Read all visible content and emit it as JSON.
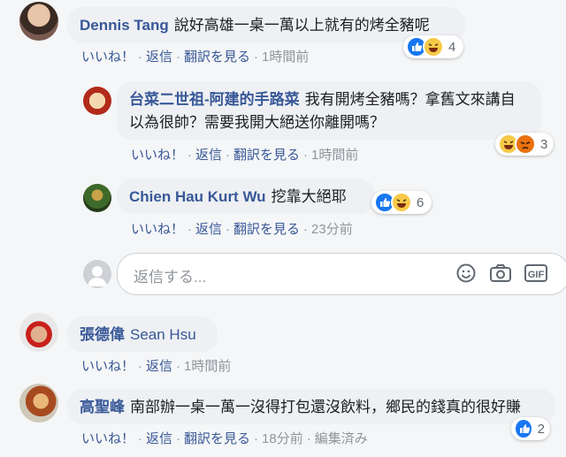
{
  "colors": {
    "link": "#385898",
    "like": "#1877f2",
    "haha": "#f7c948",
    "angry": "#e9710f",
    "bubble": "#eef0f3"
  },
  "comments": [
    {
      "name": "Dennis Tang",
      "text": "說好高雄一桌一萬以上就有的烤全豬呢",
      "actions": [
        "いいね！",
        "返信",
        "翻訳を見る"
      ],
      "time": "1時間前",
      "reactions": [
        "like",
        "haha"
      ],
      "reaction_count": "4"
    },
    {
      "name": "台菜二世祖-阿建的手路菜",
      "text_line1": "我有開烤全豬嗎？拿舊文來講自",
      "text_line2": "以為很帥？需要我開大絕送你離開嗎？",
      "actions": [
        "いいね！",
        "返信",
        "翻訳を見る"
      ],
      "time": "1時間前",
      "reactions": [
        "haha",
        "angry"
      ],
      "reaction_count": "3"
    },
    {
      "name": "Chien Hau Kurt Wu",
      "text": "挖靠大絕耶",
      "actions": [
        "いいね！",
        "返信",
        "翻訳を見る"
      ],
      "time": "23分前",
      "reactions": [
        "like",
        "haha"
      ],
      "reaction_count": "6"
    },
    {
      "name": "張德偉",
      "name_tag": "Sean Hsu",
      "actions": [
        "いいね！",
        "返信"
      ],
      "time": "1時間前"
    },
    {
      "name": "高聖峰",
      "text": "南部辦一桌一萬一沒得打包還沒飲料，鄉民的錢真的很好賺",
      "actions": [
        "いいね！",
        "返信",
        "翻訳を見る"
      ],
      "time": "18分前",
      "edited": "編集済み",
      "reactions": [
        "like"
      ],
      "reaction_count": "2"
    }
  ],
  "reply_box": {
    "placeholder": "返信する...",
    "icons": [
      "emoji-icon",
      "camera-icon",
      "gif-icon"
    ],
    "gif_label": "GIF"
  }
}
